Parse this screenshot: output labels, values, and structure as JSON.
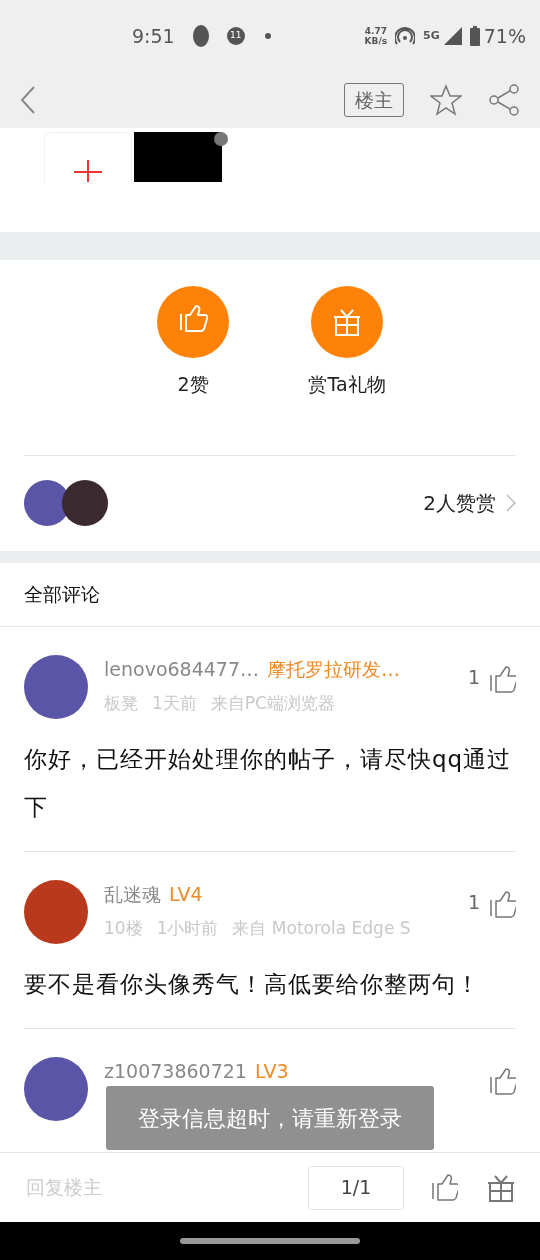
{
  "status_bar": {
    "time": "9:51",
    "notification_count": "11",
    "net_speed_value": "4.77",
    "net_speed_unit": "KB/s",
    "network": "5G",
    "battery": "71%"
  },
  "nav": {
    "owner_button": "楼主"
  },
  "actions": [
    {
      "kind": "like",
      "label": "2赞"
    },
    {
      "kind": "gift",
      "label": "赏Ta礼物"
    }
  ],
  "rewards": {
    "summary": "2人赞赏"
  },
  "comments_title": "全部评论",
  "comments": [
    {
      "name": "lenovo684477…",
      "tag": "摩托罗拉研发…",
      "meta": [
        "板凳",
        "1天前",
        "来自PC端浏览器"
      ],
      "likes": "1",
      "body": "你好，已经开始处理你的帖子，请尽快qq通过下"
    },
    {
      "name": "乱迷魂",
      "tag": "LV4",
      "meta": [
        "10楼",
        "1小时前",
        "来自 Motorola Edge S"
      ],
      "likes": "1",
      "body": "要不是看你头像秀气！高低要给你整两句！"
    },
    {
      "name": "z10073860721",
      "tag": "LV3"
    }
  ],
  "toast": "登录信息超时，请重新登录",
  "bottom_bar": {
    "reply_placeholder": "回复楼主",
    "page": "1/1"
  }
}
